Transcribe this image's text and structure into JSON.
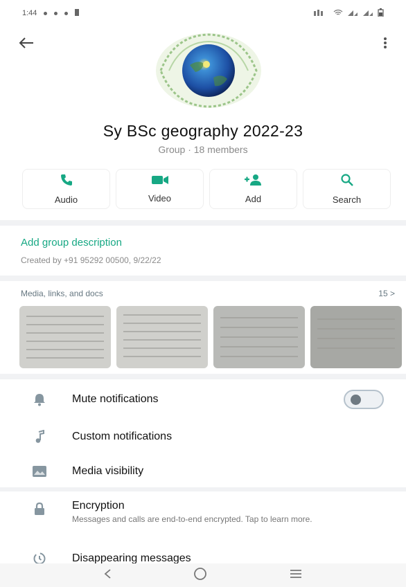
{
  "status_bar": {
    "time": "1:44"
  },
  "header": {
    "back_icon": "arrow-left-icon",
    "menu_icon": "more-vertical-icon"
  },
  "group": {
    "name": "Sy BSc geography 2022-23",
    "subtitle": "Group · 18 members"
  },
  "actions": [
    {
      "label": "Audio",
      "icon": "phone-icon"
    },
    {
      "label": "Video",
      "icon": "videocam-icon"
    },
    {
      "label": "Add",
      "icon": "person-add-icon"
    },
    {
      "label": "Search",
      "icon": "search-icon"
    }
  ],
  "description": {
    "link": "Add group description",
    "created": "Created by +91 95292 00500, 9/22/22"
  },
  "media": {
    "title": "Media, links, and docs",
    "count": "15 >"
  },
  "settings": {
    "mute": "Mute notifications",
    "custom": "Custom notifications",
    "visibility": "Media visibility",
    "encryption_title": "Encryption",
    "encryption_sub": "Messages and calls are end-to-end encrypted. Tap to learn more.",
    "disappearing": "Disappearing messages"
  },
  "colors": {
    "accent": "#17a884",
    "icon_gray": "#8696a0"
  }
}
